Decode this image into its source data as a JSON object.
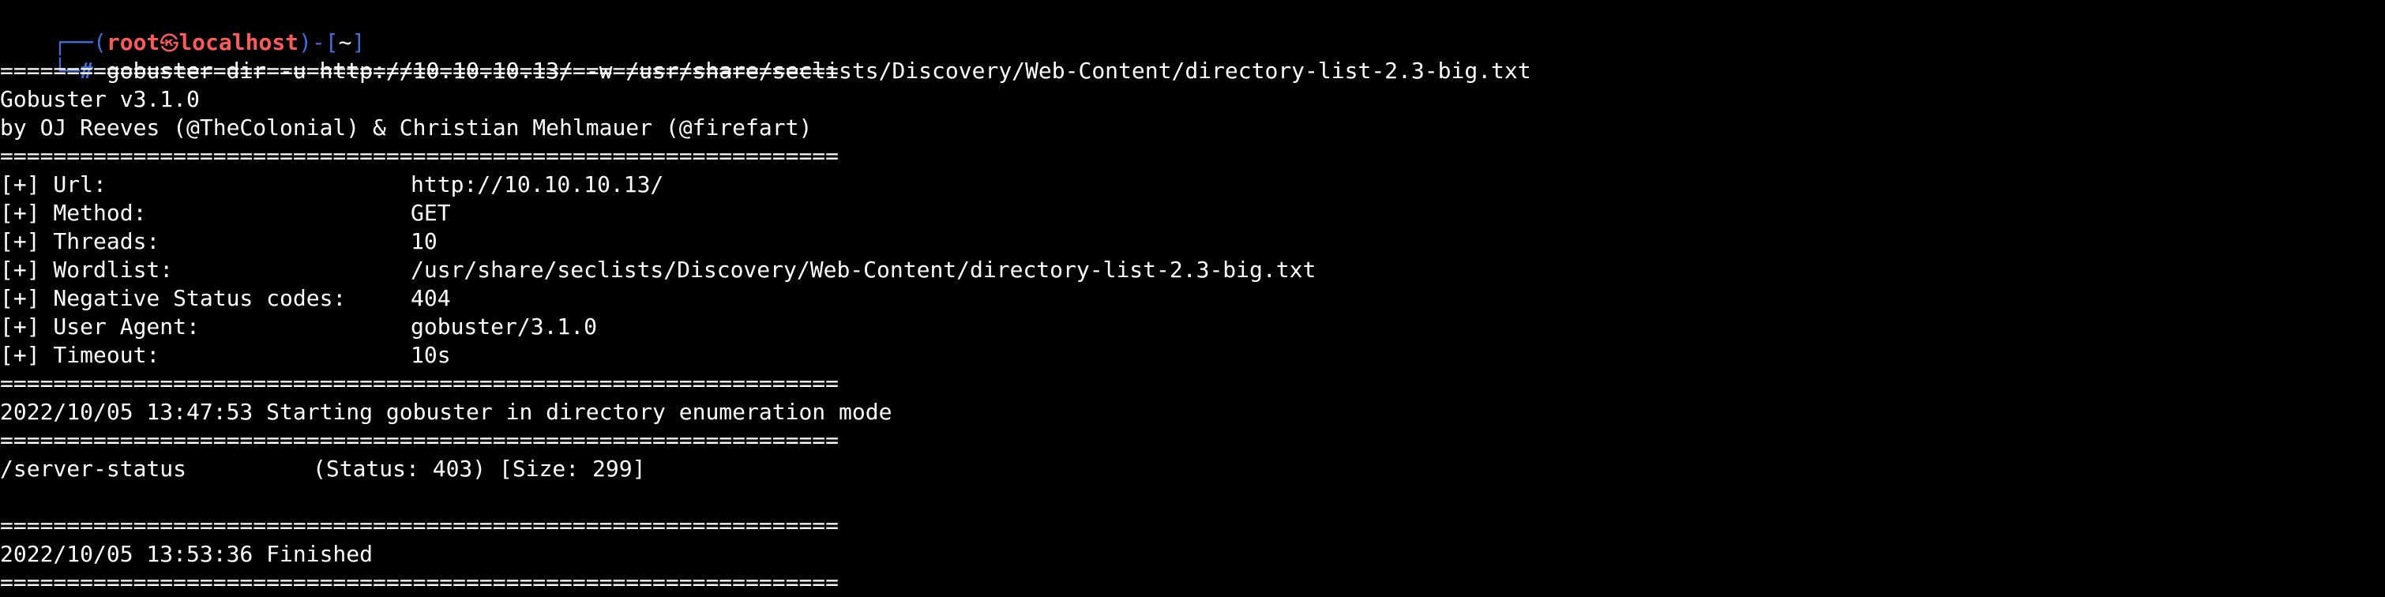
{
  "prompt": {
    "open": "┌──(",
    "user": "root",
    "skull": "㉿",
    "host": "localhost",
    "mid": ")-[",
    "cwd": "~",
    "close": "]",
    "corner": "└─",
    "hash": "#",
    "command": " gobuster dir -u http://10.10.10.13/ -w /usr/share/seclists/Discovery/Web-Content/directory-list-2.3-big.txt"
  },
  "separator": "===============================================================",
  "banner": {
    "version": "Gobuster v3.1.0",
    "authors": "by OJ Reeves (@TheColonial) & Christian Mehlmauer (@firefart)"
  },
  "config": [
    {
      "key": "[+] Url:",
      "value": "http://10.10.10.13/"
    },
    {
      "key": "[+] Method:",
      "value": "GET"
    },
    {
      "key": "[+] Threads:",
      "value": "10"
    },
    {
      "key": "[+] Wordlist:",
      "value": "/usr/share/seclists/Discovery/Web-Content/directory-list-2.3-big.txt"
    },
    {
      "key": "[+] Negative Status codes:",
      "value": "404"
    },
    {
      "key": "[+] User Agent:",
      "value": "gobuster/3.1.0"
    },
    {
      "key": "[+] Timeout:",
      "value": "10s"
    }
  ],
  "start_message": "2022/10/05 13:47:53 Starting gobuster in directory enumeration mode",
  "results": [
    {
      "path": "/server-status",
      "details": "(Status: 403) [Size: 299]"
    }
  ],
  "finish_message": "2022/10/05 13:53:36 Finished",
  "colors": {
    "background": "#000000",
    "prompt_blue": "#3f6fd8",
    "prompt_red": "#ff5a5a",
    "text": "#ffffff"
  }
}
